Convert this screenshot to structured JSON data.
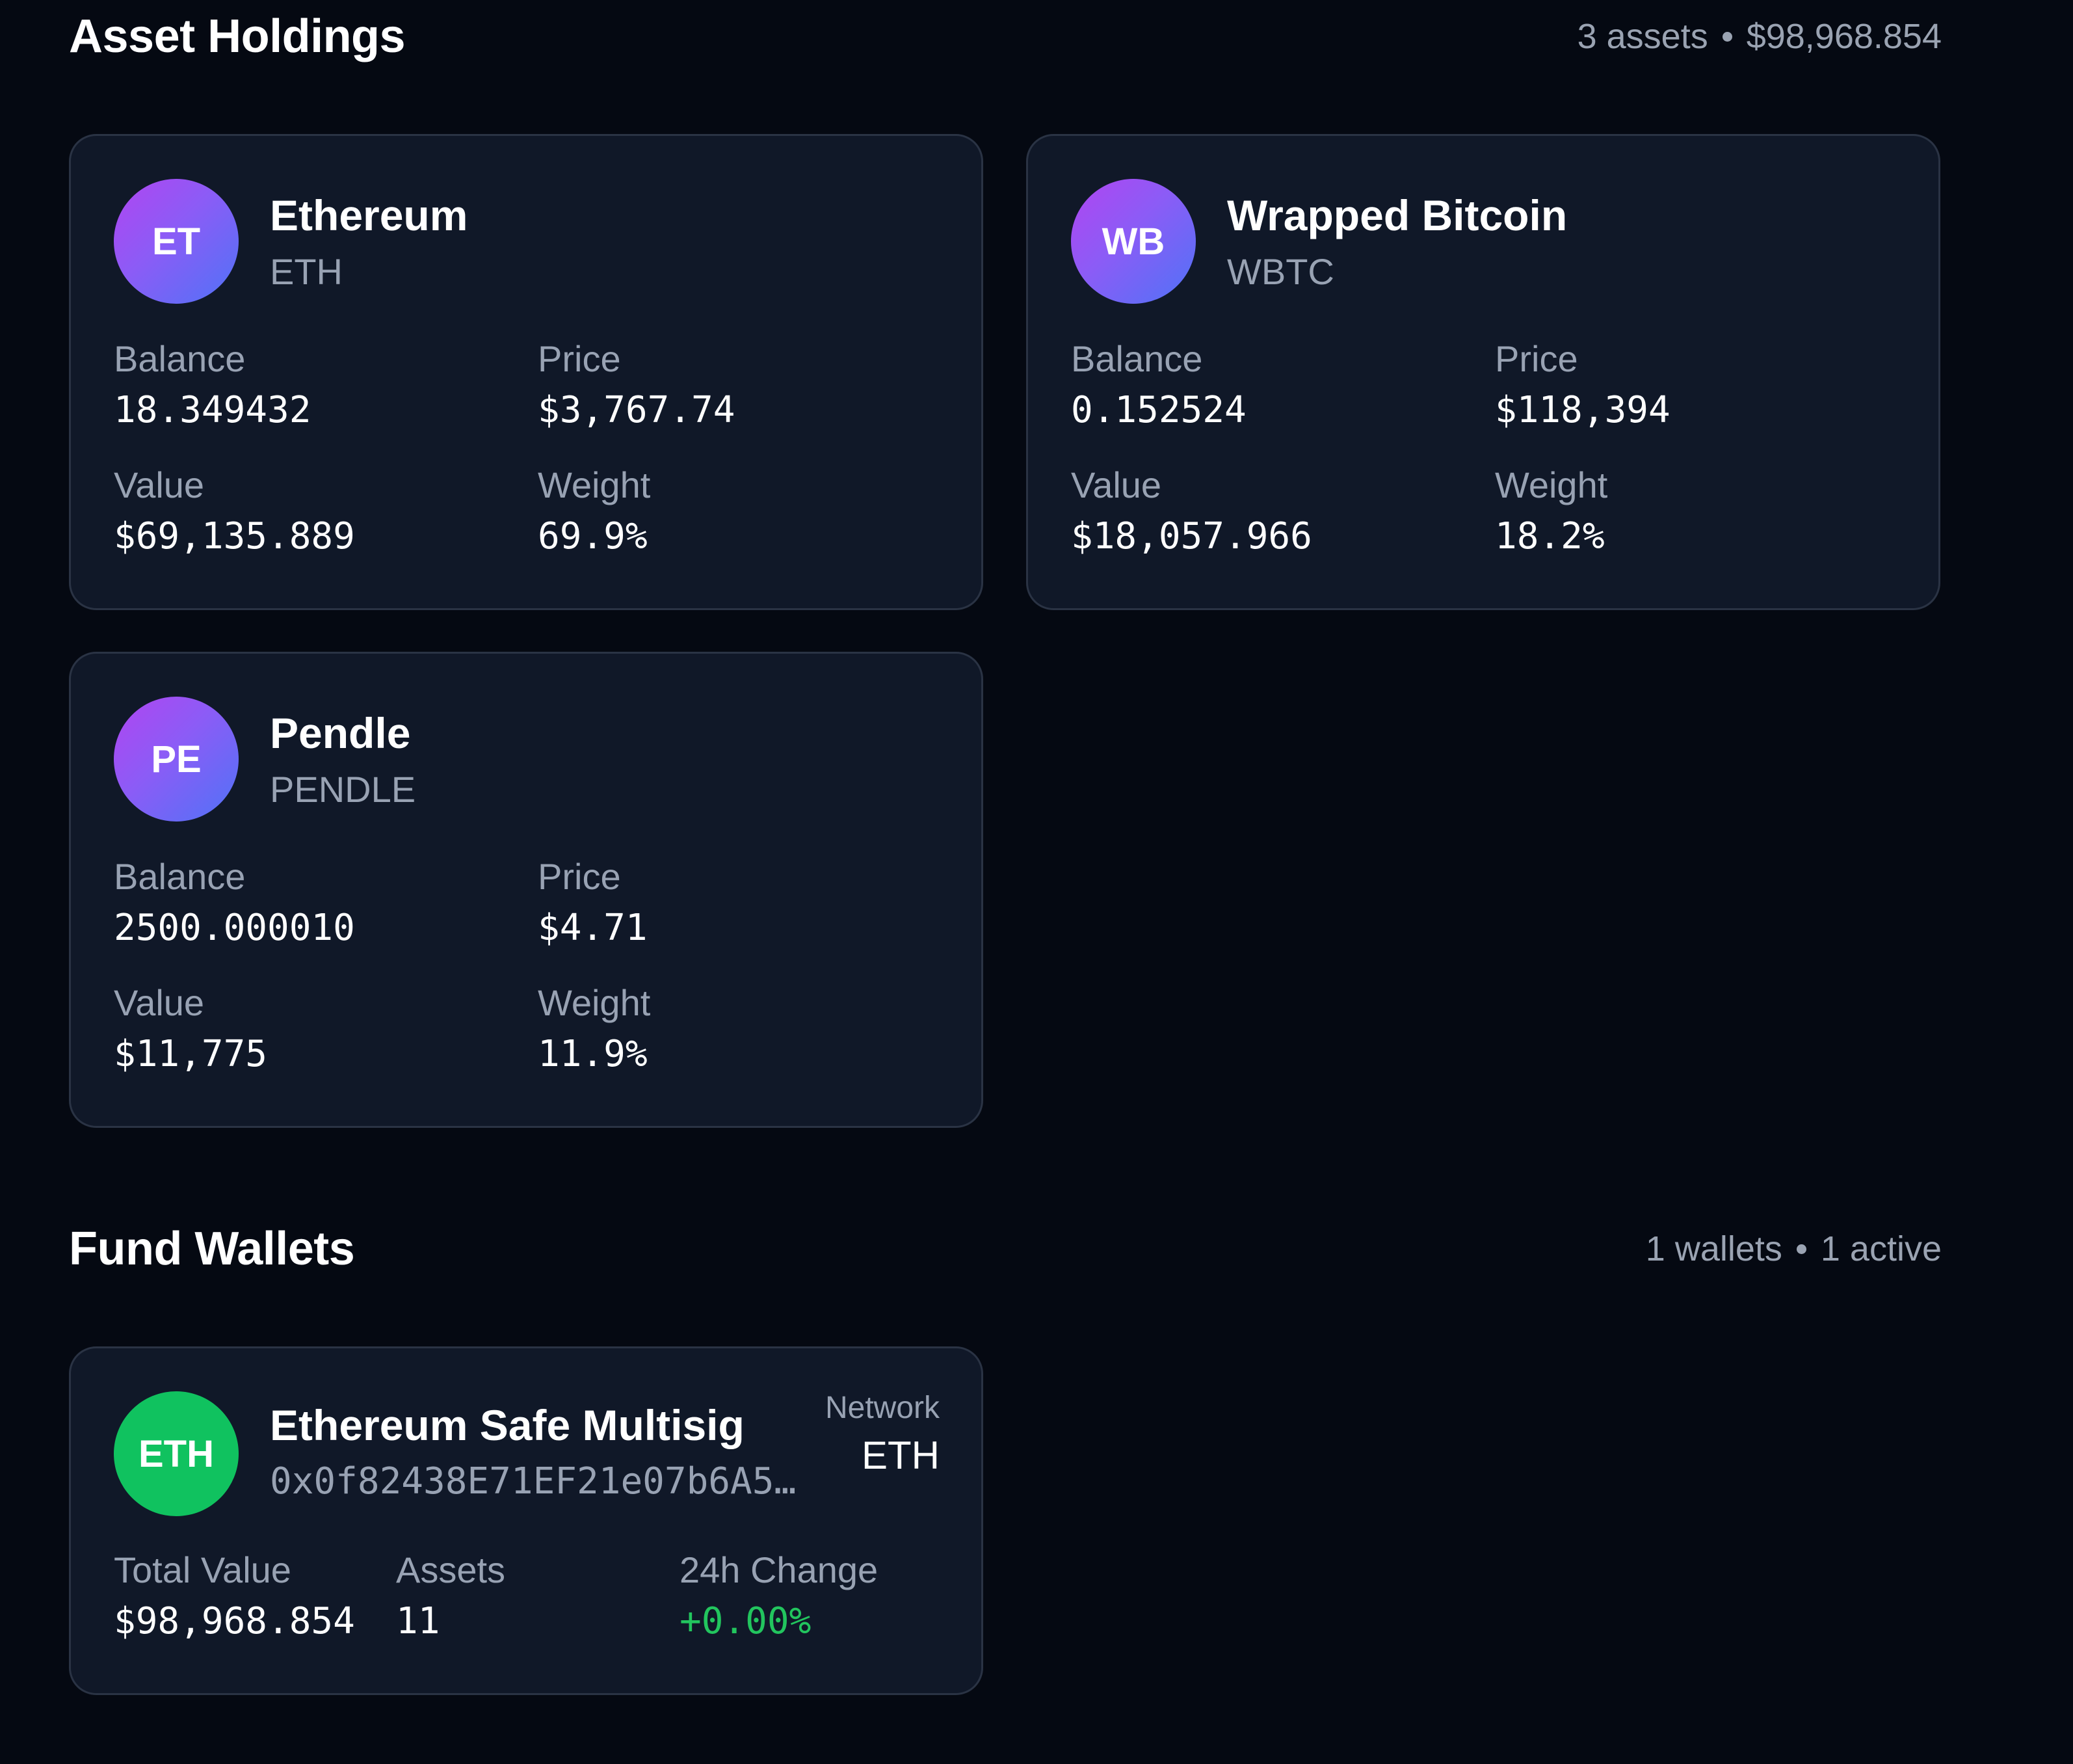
{
  "holdings": {
    "title": "Asset Holdings",
    "count_text": "3 assets",
    "total_text": "$98,968.854",
    "assets": [
      {
        "initials": "ET",
        "name": "Ethereum",
        "symbol": "ETH",
        "balance_label": "Balance",
        "balance": "18.349432",
        "price_label": "Price",
        "price": "$3,767.74",
        "value_label": "Value",
        "value": "$69,135.889",
        "weight_label": "Weight",
        "weight": "69.9%"
      },
      {
        "initials": "WB",
        "name": "Wrapped Bitcoin",
        "symbol": "WBTC",
        "balance_label": "Balance",
        "balance": "0.152524",
        "price_label": "Price",
        "price": "$118,394",
        "value_label": "Value",
        "value": "$18,057.966",
        "weight_label": "Weight",
        "weight": "18.2%"
      },
      {
        "initials": "PE",
        "name": "Pendle",
        "symbol": "PENDLE",
        "balance_label": "Balance",
        "balance": "2500.000010",
        "price_label": "Price",
        "price": "$4.71",
        "value_label": "Value",
        "value": "$11,775",
        "weight_label": "Weight",
        "weight": "11.9%"
      }
    ]
  },
  "wallets": {
    "title": "Fund Wallets",
    "count_text": "1 wallets",
    "active_text": "1 active",
    "items": [
      {
        "badge": "ETH",
        "name": "Ethereum Safe Multisig",
        "address": "0x0f82438E71EF21e07b6A5…",
        "network_label": "Network",
        "network": "ETH",
        "total_value_label": "Total Value",
        "total_value": "$98,968.854",
        "assets_label": "Assets",
        "assets": "11",
        "change_label": "24h Change",
        "change": "+0.00%"
      }
    ]
  },
  "colors": {
    "background": "#050912",
    "card": "#101828",
    "avatar_gradient_start": "#b145f1",
    "avatar_gradient_end": "#4f73f7",
    "wallet_badge": "#10c25f",
    "positive": "#22c55e"
  }
}
